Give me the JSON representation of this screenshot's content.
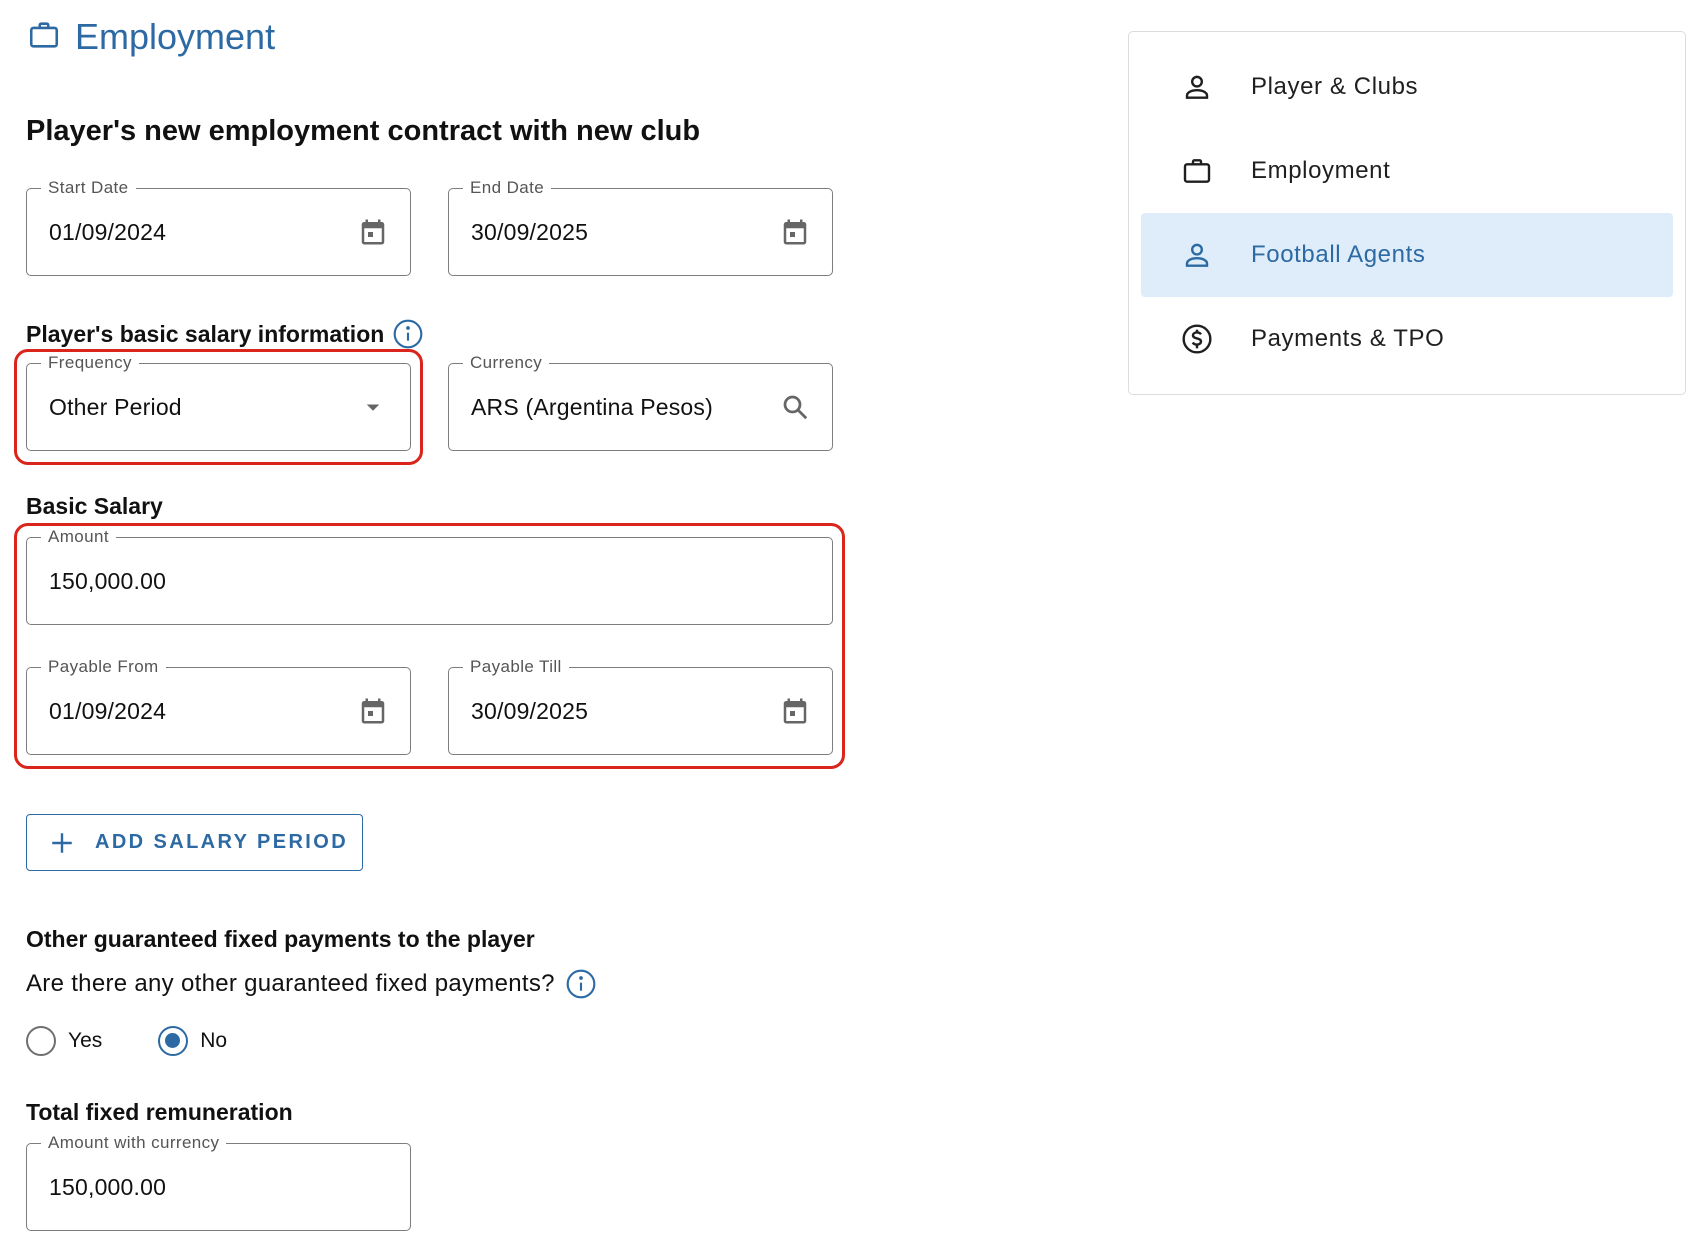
{
  "header": {
    "title": "Employment",
    "icon": "briefcase-icon"
  },
  "contract": {
    "title": "Player's new employment contract with new club",
    "start_date": {
      "label": "Start Date",
      "value": "01/09/2024"
    },
    "end_date": {
      "label": "End Date",
      "value": "30/09/2025"
    }
  },
  "salary_info": {
    "title": "Player's basic salary information",
    "frequency": {
      "label": "Frequency",
      "value": "Other Period"
    },
    "currency": {
      "label": "Currency",
      "value": "ARS (Argentina Pesos)"
    }
  },
  "basic_salary": {
    "title": "Basic Salary",
    "amount": {
      "label": "Amount",
      "value": "150,000.00"
    },
    "payable_from": {
      "label": "Payable From",
      "value": "01/09/2024"
    },
    "payable_till": {
      "label": "Payable Till",
      "value": "30/09/2025"
    },
    "add_button": "ADD SALARY PERIOD"
  },
  "other_payments": {
    "title": "Other guaranteed fixed payments to the player",
    "question": "Are there any other guaranteed fixed payments?",
    "options": [
      "Yes",
      "No"
    ],
    "selected": "No"
  },
  "total": {
    "title": "Total fixed remuneration",
    "field": {
      "label": "Amount with currency",
      "value": "150,000.00"
    }
  },
  "nav": {
    "items": [
      {
        "label": "Player & Clubs",
        "icon": "person-icon"
      },
      {
        "label": "Employment",
        "icon": "briefcase-icon"
      },
      {
        "label": "Football Agents",
        "icon": "person-icon"
      },
      {
        "label": "Payments & TPO",
        "icon": "dollar-circle-icon"
      }
    ],
    "active": "Football Agents"
  },
  "colors": {
    "accent": "#2d6aa3",
    "highlight": "#d9251c",
    "active_bg": "#deedf9"
  }
}
